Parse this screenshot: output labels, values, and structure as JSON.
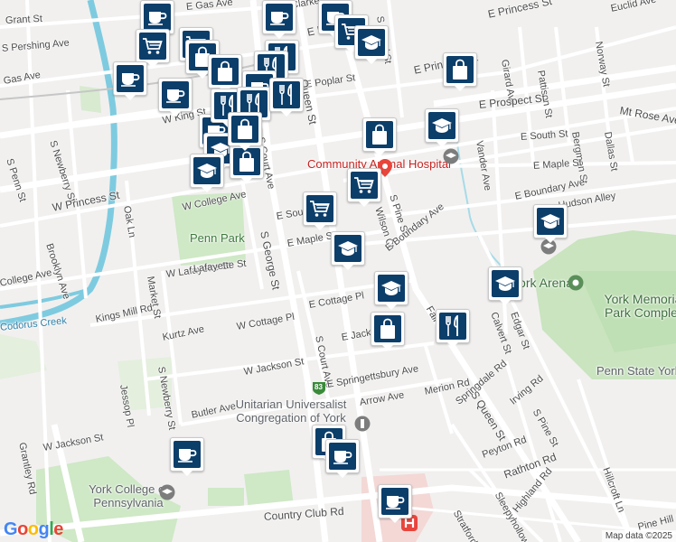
{
  "map": {
    "street_labels": [
      "Grant St",
      "S Pershing Ave",
      "Gas Ave",
      "S Newberry St",
      "S Penn St",
      "W King St",
      "W Princess St",
      "W College Ave",
      "Oak Ln",
      "Brooklyn Ave",
      "College Ave",
      "Market St",
      "W Lafayette St",
      "Kings Mill Rd",
      "Kurtz Ave",
      "W Cottage Pl",
      "W Jackson St",
      "S Newberry St",
      "Jessop Pl",
      "Butler Ave",
      "W Jackson St",
      "Grantley Rd",
      "Country Club Rd",
      "E Gas Ave",
      "E Clarke Ave",
      "E Market St",
      "E Poplar St",
      "E Princess St",
      "S Broad St",
      "E Princess St",
      "Euclid Ave",
      "Norway St",
      "Girard Ave",
      "Pattison St",
      "E Prospect St",
      "Mt Rose Ave",
      "Bergman St",
      "Dallas St",
      "Vander Ave",
      "E South St",
      "E Maple St",
      "E Boundary Ave",
      "Hudson Alley",
      "S Pine St",
      "Wilson Ct",
      "E Boundary Ave",
      "E Maple St",
      "E South St",
      "S Court Ave",
      "S George St",
      "Lafayette St",
      "E Cottage Pl",
      "E Jackson St",
      "S Court Ave",
      "E Springettsbury Ave",
      "Arrow Ave",
      "Merion Rd",
      "S Queen St",
      "Springdale Rd",
      "Irving Rd",
      "S Pine St",
      "Calvert St",
      "Edgar St",
      "Peyton Rd",
      "Rathton Rd",
      "Highland Rd",
      "Sleepyhollow Rd",
      "Stratford Rd",
      "Hillcroft Ln",
      "Pine Hill Rd",
      "Queen St",
      "Fairview"
    ],
    "pois": {
      "community_animal_hospital": "Community Animal Hospital",
      "penn_park": "Penn Park",
      "codorus_creek": "Codorus Creek",
      "york_arena": "York Arena",
      "york_memorial_park": "York Memorial Park Complex",
      "penn_state_york": "Penn State York",
      "unitarian": "Unitarian Universalist Congregation of York",
      "york_college": "York College of Pennsylvania",
      "route_shield": "83"
    },
    "footer": {
      "logo": "Google",
      "attribution": "Map data ©2025"
    }
  },
  "markers": [
    {
      "icon": "coffee"
    },
    {
      "icon": "shopping-cart"
    },
    {
      "icon": "coffee"
    },
    {
      "icon": "shopping-cart"
    },
    {
      "icon": "shopping-bag"
    },
    {
      "icon": "coffee"
    },
    {
      "icon": "shopping-bag"
    },
    {
      "icon": "restaurant"
    },
    {
      "icon": "restaurant"
    },
    {
      "icon": "coffee"
    },
    {
      "icon": "coffee"
    },
    {
      "icon": "restaurant"
    },
    {
      "icon": "restaurant"
    },
    {
      "icon": "restaurant"
    },
    {
      "icon": "restaurant"
    },
    {
      "icon": "school"
    },
    {
      "icon": "shopping-bag"
    },
    {
      "icon": "school"
    },
    {
      "icon": "shopping-bag"
    },
    {
      "icon": "coffee"
    },
    {
      "icon": "shopping-cart"
    },
    {
      "icon": "school"
    },
    {
      "icon": "shopping-bag"
    },
    {
      "icon": "shopping-cart"
    },
    {
      "icon": "shopping-cart"
    },
    {
      "icon": "school"
    },
    {
      "icon": "school"
    },
    {
      "icon": "school"
    },
    {
      "icon": "school"
    },
    {
      "icon": "shopping-bag"
    },
    {
      "icon": "restaurant"
    },
    {
      "icon": "school"
    },
    {
      "icon": "shopping-bag"
    },
    {
      "icon": "coffee"
    },
    {
      "icon": "coffee"
    },
    {
      "icon": "coffee"
    },
    {
      "icon": "shopping-bag"
    },
    {
      "icon": "coffee"
    }
  ],
  "colors": {
    "marker_fill": "#0c3e6a",
    "water": "#7ecbe0",
    "park": "#cfe8c6",
    "road": "#ffffff",
    "hospital": "#e8453c"
  }
}
